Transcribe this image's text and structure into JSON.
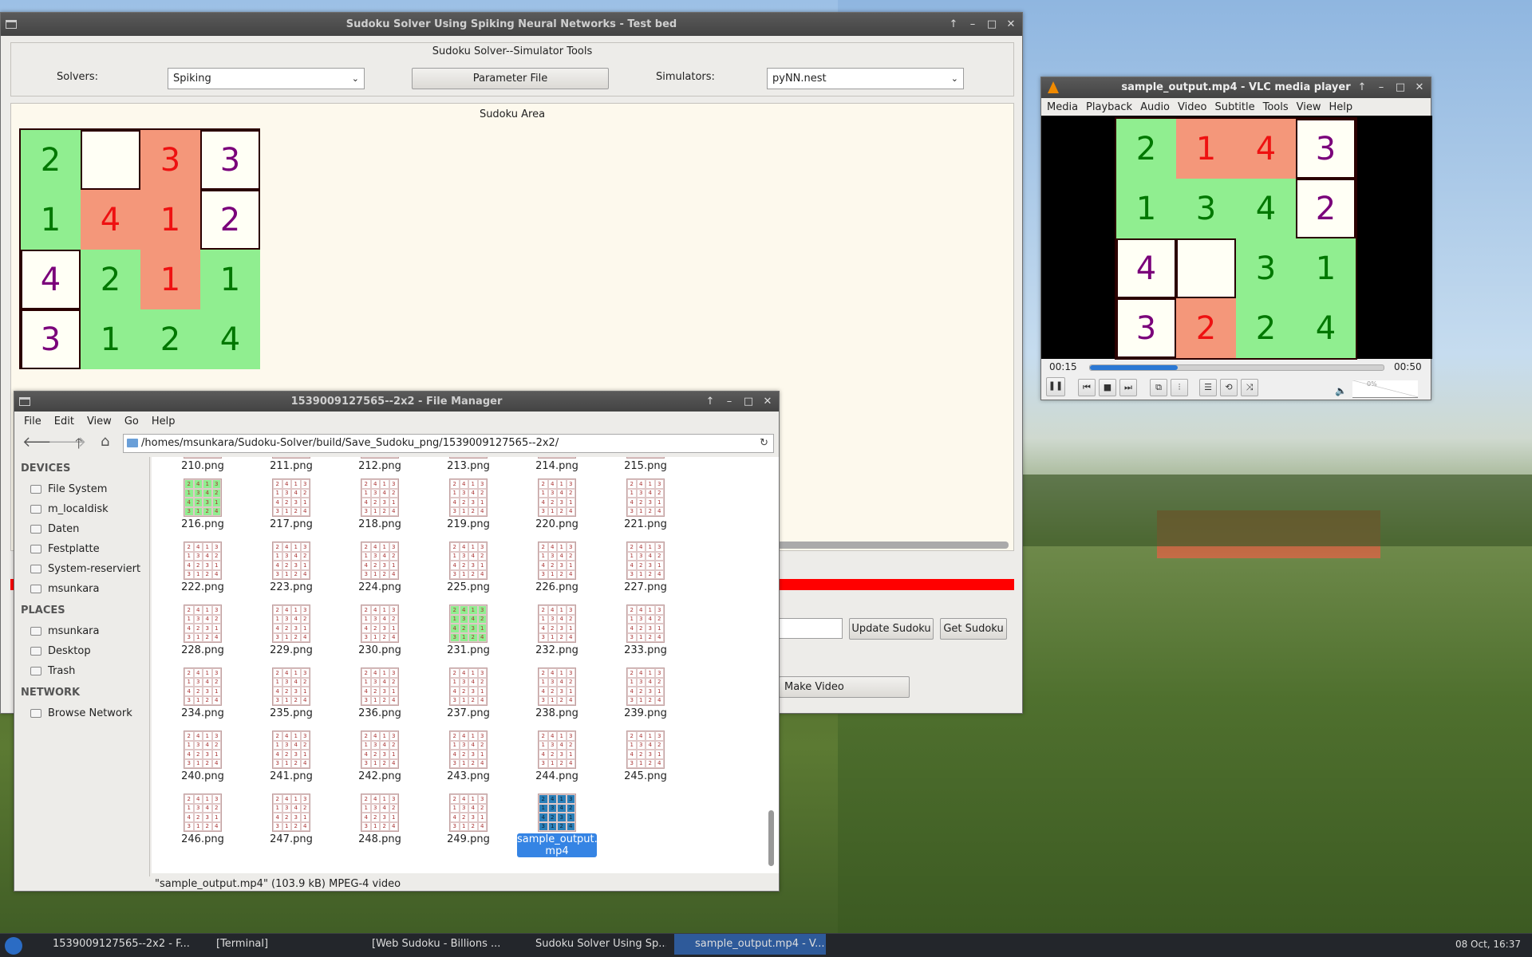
{
  "desktop": {
    "wallpaper": "meadow-village-landscape"
  },
  "sudoku_window": {
    "title": "Sudoku Solver Using Spiking Neural Networks - Test bed",
    "group_label": "Sudoku Solver--Simulator Tools",
    "solvers_label": "Solvers:",
    "solver_value": "Spiking",
    "param_button": "Parameter File",
    "simulators_label": "Simulators:",
    "simulator_value": "pyNN.nest",
    "area_label": "Sudoku Area",
    "grid": [
      [
        "2",
        "",
        "3",
        "3"
      ],
      [
        "1",
        "4",
        "1",
        "2"
      ],
      [
        "4",
        "2",
        "1",
        "1"
      ],
      [
        "3",
        "1",
        "2",
        "4"
      ]
    ],
    "update_button": "Update Sudoku",
    "get_button": "Get Sudoku",
    "make_video_button": "Make Video",
    "colors": {
      "green": "#90ee90",
      "salmon": "#f4977a",
      "white": "#fffff5",
      "text_green": "#007700",
      "text_red": "#ee1111",
      "text_purple": "#7a007a"
    }
  },
  "vlc": {
    "title": "sample_output.mp4 - VLC media player",
    "menu": [
      "Media",
      "Playback",
      "Audio",
      "Video",
      "Subtitle",
      "Tools",
      "View",
      "Help"
    ],
    "grid": [
      [
        "2",
        "1",
        "4",
        "3"
      ],
      [
        "1",
        "3",
        "4",
        "2"
      ],
      [
        "4",
        "",
        "3",
        "1"
      ],
      [
        "3",
        "2",
        "2",
        "4"
      ]
    ],
    "time_elapsed": "00:15",
    "time_total": "00:50",
    "progress": 0.3,
    "volume": "0%"
  },
  "file_manager": {
    "title": "1539009127565--2x2 - File Manager",
    "menu": [
      "File",
      "Edit",
      "View",
      "Go",
      "Help"
    ],
    "path": "/homes/msunkara/Sudoku-Solver/build/Save_Sudoku_png/1539009127565--2x2/",
    "devices_header": "DEVICES",
    "devices": [
      "File System",
      "m_localdisk",
      "Daten",
      "Festplatte",
      "System-reserviert",
      "msunkara"
    ],
    "places_header": "PLACES",
    "places": [
      "msunkara",
      "Desktop",
      "Trash"
    ],
    "network_header": "NETWORK",
    "network": [
      "Browse Network"
    ],
    "files": [
      "210.png",
      "211.png",
      "212.png",
      "213.png",
      "214.png",
      "215.png",
      "216.png",
      "217.png",
      "218.png",
      "219.png",
      "220.png",
      "221.png",
      "222.png",
      "223.png",
      "224.png",
      "225.png",
      "226.png",
      "227.png",
      "228.png",
      "229.png",
      "230.png",
      "231.png",
      "232.png",
      "233.png",
      "234.png",
      "235.png",
      "236.png",
      "237.png",
      "238.png",
      "239.png",
      "240.png",
      "241.png",
      "242.png",
      "243.png",
      "244.png",
      "245.png",
      "246.png",
      "247.png",
      "248.png",
      "249.png",
      "sample_output.\nmp4"
    ],
    "status": "\"sample_output.mp4\" (103.9 kB) MPEG-4 video"
  },
  "taskbar": {
    "tasks": [
      "1539009127565--2x2 - F...",
      "[Terminal]",
      "[Web Sudoku - Billions ...",
      "Sudoku Solver Using Sp...",
      "sample_output.mp4 - V..."
    ],
    "clock": "08 Oct, 16:37"
  }
}
